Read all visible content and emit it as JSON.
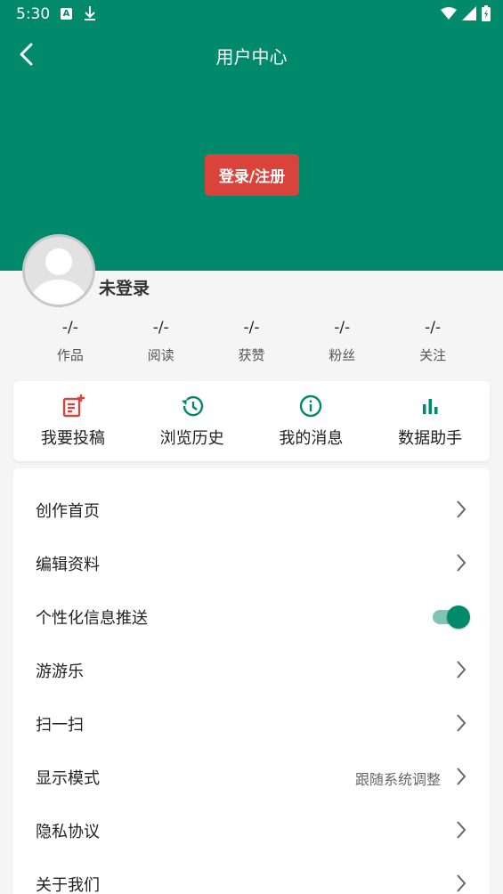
{
  "status": {
    "time": "5:30",
    "notif_a": "A"
  },
  "header": {
    "title": "用户中心",
    "login_label": "登录/注册"
  },
  "user": {
    "name": "未登录"
  },
  "stats": [
    {
      "value": "-/-",
      "label": "作品"
    },
    {
      "value": "-/-",
      "label": "阅读"
    },
    {
      "value": "-/-",
      "label": "获赞"
    },
    {
      "value": "-/-",
      "label": "粉丝"
    },
    {
      "value": "-/-",
      "label": "关注"
    }
  ],
  "quick": [
    {
      "label": "我要投稿",
      "icon": "post-icon",
      "color": "#d9433b"
    },
    {
      "label": "浏览历史",
      "icon": "history-icon",
      "color": "#00896a"
    },
    {
      "label": "我的消息",
      "icon": "info-icon",
      "color": "#00896a"
    },
    {
      "label": "数据助手",
      "icon": "bar-chart-icon",
      "color": "#00896a"
    }
  ],
  "menu": [
    {
      "label": "创作首页"
    },
    {
      "label": "编辑资料"
    },
    {
      "label": "个性化信息推送",
      "toggle": true
    },
    {
      "label": "游游乐"
    },
    {
      "label": "扫一扫"
    },
    {
      "label": "显示模式",
      "value": "跟随系统调整"
    },
    {
      "label": "隐私协议"
    },
    {
      "label": "关于我们"
    }
  ],
  "colors": {
    "primary": "#00896a",
    "accent": "#d9433b"
  }
}
